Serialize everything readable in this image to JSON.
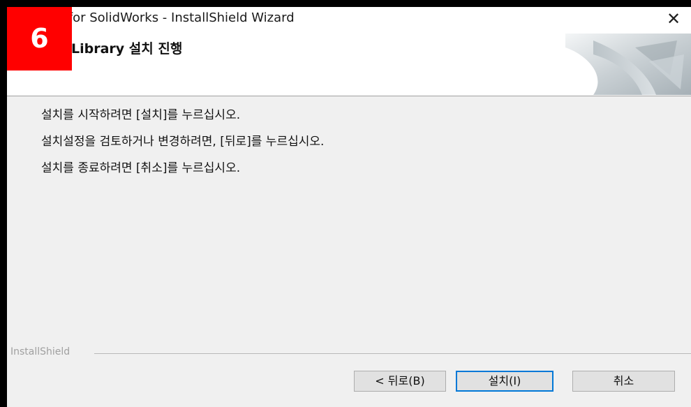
{
  "window": {
    "title": "ry for SolidWorks - InstallShield Wizard",
    "close_glyph": "✕"
  },
  "header": {
    "subtitle": "Library 설치 진행",
    "art_icon": "folded-paper-icon"
  },
  "badge": {
    "label": "6"
  },
  "content": {
    "lines": [
      "설치를 시작하려면 [설치]를 누르십시오.",
      "설치설정을 검토하거나 변경하려면, [뒤로]를 누르십시오.",
      "설치를 종료하려면 [취소]를 누르십시오."
    ]
  },
  "footer": {
    "brand": "InstallShield",
    "buttons": {
      "back": "< 뒤로(B)",
      "install": "설치(I)",
      "cancel": "취소"
    }
  }
}
